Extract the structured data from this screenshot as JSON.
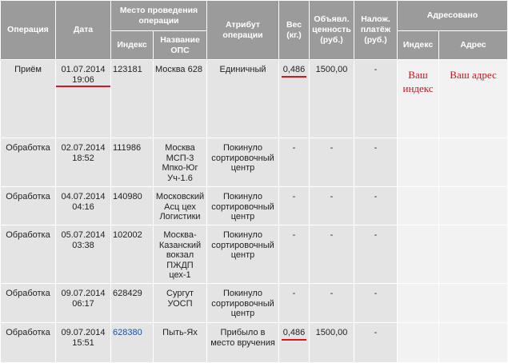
{
  "headers": {
    "operation": "Операция",
    "date": "Дата",
    "place": "Место проведения операции",
    "index": "Индекс",
    "ops_name": "Название ОПС",
    "attribute": "Атрибут операции",
    "weight": "Вес (кг.)",
    "declared_value": "Объявл. ценность (руб.)",
    "cod": "Налож. платёж (руб.)",
    "addressed": "Адресовано",
    "addr_index": "Индекс",
    "addr_address": "Адрес"
  },
  "rows": [
    {
      "operation": "Приём",
      "date": "01.07.2014 19:06",
      "index": "123181",
      "ops": "Москва 628",
      "attribute": "Единичный",
      "weight": "0,486",
      "value": "1500,00",
      "cod": "-"
    },
    {
      "operation": "Обработка",
      "date": "02.07.2014 18:52",
      "index": "111986",
      "ops": "Москва МСП-3 Мпко-Юг Уч-1.6",
      "attribute": "Покинуло сортировочный центр",
      "weight": "-",
      "value": "-",
      "cod": "-"
    },
    {
      "operation": "Обработка",
      "date": "04.07.2014 04:16",
      "index": "140980",
      "ops": "Московский Асц цех Логистики",
      "attribute": "Покинуло сортировочный центр",
      "weight": "-",
      "value": "-",
      "cod": "-"
    },
    {
      "operation": "Обработка",
      "date": "05.07.2014 03:38",
      "index": "102002",
      "ops": "Москва-Казанский вокзал ПЖДП цех-1",
      "attribute": "Покинуло сортировочный центр",
      "weight": "-",
      "value": "-",
      "cod": "-"
    },
    {
      "operation": "Обработка",
      "date": "09.07.2014 06:17",
      "index": "628429",
      "ops": "Сургут УОСП",
      "attribute": "Покинуло сортировочный центр",
      "weight": "-",
      "value": "-",
      "cod": "-"
    },
    {
      "operation": "Обработка",
      "date": "09.07.2014 15:51",
      "index": "628380",
      "ops": "Пыть-Ях",
      "attribute": "Прибыло в место вручения",
      "weight": "0,486",
      "value": "1500,00",
      "cod": "-"
    }
  ],
  "annotations": {
    "your_index": "Ваш индекс",
    "your_address": "Ваш адрес"
  },
  "colors": {
    "header_bg": "#9b9b9b",
    "cell_bg": "#e4e4e4",
    "addr_bg": "#f2f2f2",
    "underline": "#d8141e",
    "annotation": "#c8141e",
    "link": "#1f4f9c"
  }
}
